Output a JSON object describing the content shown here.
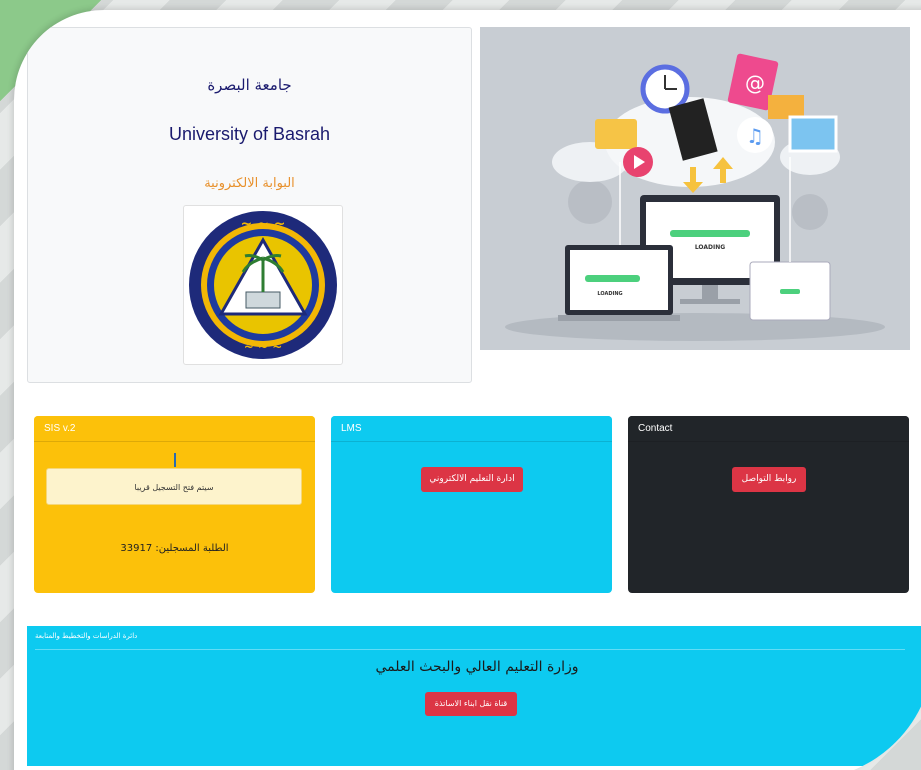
{
  "header": {
    "arabic_title": "جامعة البصرة",
    "english_title": "University of Basrah",
    "portal_title": "البوابة الالكترونية"
  },
  "hero": {
    "loading_big": "LOADING",
    "loading_small": "LOADING"
  },
  "cards": {
    "sis": {
      "title": "SIS v.2",
      "notice": "سيتم فتح التسجيل قريبا",
      "students_label": "الطلبة المسجلين:",
      "students_count": "33917"
    },
    "lms": {
      "title": "LMS",
      "button": "ادارة التعليم الالكتروني"
    },
    "contact": {
      "title": "Contact",
      "button": "روابط التواصل"
    }
  },
  "footer": {
    "header": "دائرة الدراسات والتخطيط والمتابعة",
    "title": "وزارة التعليم العالي والبحث العلمي",
    "button": "قناة نقل ابناء الاساتذة"
  },
  "colors": {
    "sis": "#fcc10a",
    "lms": "#0dcaf0",
    "contact": "#212529",
    "button": "#dc3545",
    "title": "#1a1a6e",
    "portal": "#e8912c"
  }
}
